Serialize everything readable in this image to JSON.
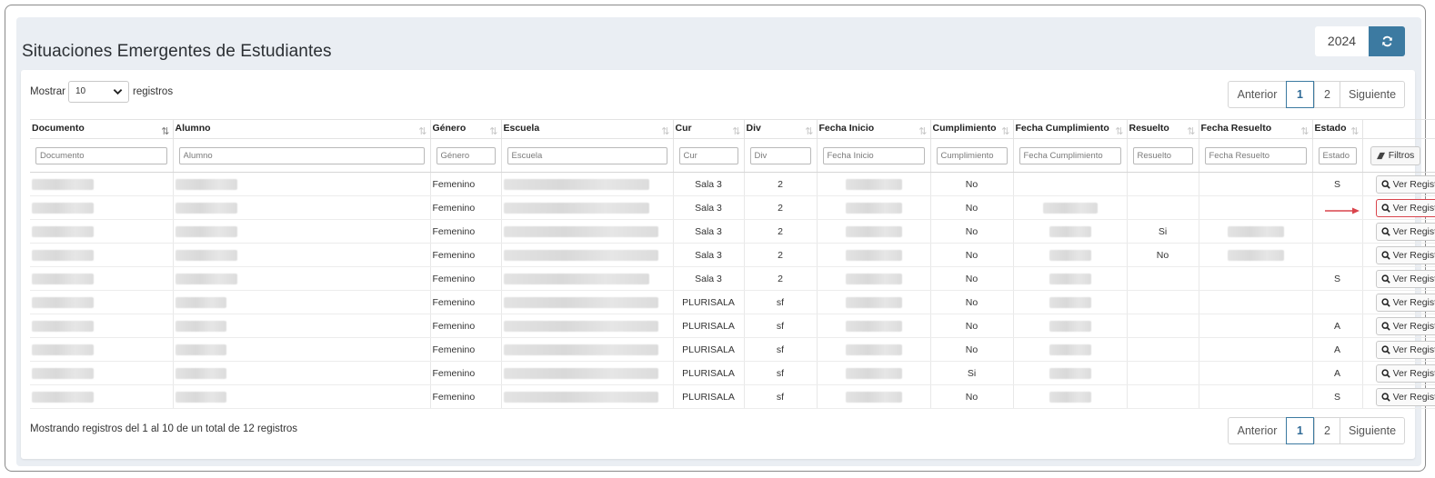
{
  "page": {
    "title": "Situaciones Emergentes de Estudiantes",
    "year": "2024",
    "refresh_icon": "refresh-icon"
  },
  "length": {
    "prefix": "Mostrar",
    "value": "10",
    "suffix": "registros"
  },
  "pagination": {
    "prev": "Anterior",
    "pages": [
      "1",
      "2"
    ],
    "active": "1",
    "next": "Siguiente"
  },
  "columns": [
    "Documento",
    "Alumno",
    "Género",
    "Escuela",
    "Cur",
    "Div",
    "Fecha Inicio",
    "Cumplimiento",
    "Fecha Cumplimiento",
    "Resuelto",
    "Fecha Resuelto",
    "Estado",
    ""
  ],
  "filters": [
    "Documento",
    "Alumno",
    "Género",
    "Escuela",
    "Cur",
    "Div",
    "Fecha Inicio",
    "Cumplimiento",
    "Fecha Cumplimiento",
    "Resuelto",
    "Fecha Resuelto",
    "Estado"
  ],
  "filtros_label": "Filtros",
  "action_label": "Ver Registro",
  "rows": [
    {
      "genero": "Femenino",
      "cur": "Sala 3",
      "div": "2",
      "cumplimiento": "No",
      "resuelto": "",
      "estado": "S"
    },
    {
      "genero": "Femenino",
      "cur": "Sala 3",
      "div": "2",
      "cumplimiento": "No",
      "resuelto": "",
      "estado": ""
    },
    {
      "genero": "Femenino",
      "cur": "Sala 3",
      "div": "2",
      "cumplimiento": "No",
      "resuelto": "Si",
      "estado": ""
    },
    {
      "genero": "Femenino",
      "cur": "Sala 3",
      "div": "2",
      "cumplimiento": "No",
      "resuelto": "No",
      "estado": ""
    },
    {
      "genero": "Femenino",
      "cur": "Sala 3",
      "div": "2",
      "cumplimiento": "No",
      "resuelto": "",
      "estado": "S"
    },
    {
      "genero": "Femenino",
      "cur": "PLURISALA",
      "div": "sf",
      "cumplimiento": "No",
      "resuelto": "",
      "estado": ""
    },
    {
      "genero": "Femenino",
      "cur": "PLURISALA",
      "div": "sf",
      "cumplimiento": "No",
      "resuelto": "",
      "estado": "A"
    },
    {
      "genero": "Femenino",
      "cur": "PLURISALA",
      "div": "sf",
      "cumplimiento": "No",
      "resuelto": "",
      "estado": "A"
    },
    {
      "genero": "Femenino",
      "cur": "PLURISALA",
      "div": "sf",
      "cumplimiento": "Si",
      "resuelto": "",
      "estado": "A"
    },
    {
      "genero": "Femenino",
      "cur": "PLURISALA",
      "div": "sf",
      "cumplimiento": "No",
      "resuelto": "",
      "estado": "S"
    }
  ],
  "footer": "Mostrando registros del 1 al 10 de un total de 12 registros",
  "colors": {
    "accent": "#3c7aa1",
    "highlight": "#d9444c"
  }
}
